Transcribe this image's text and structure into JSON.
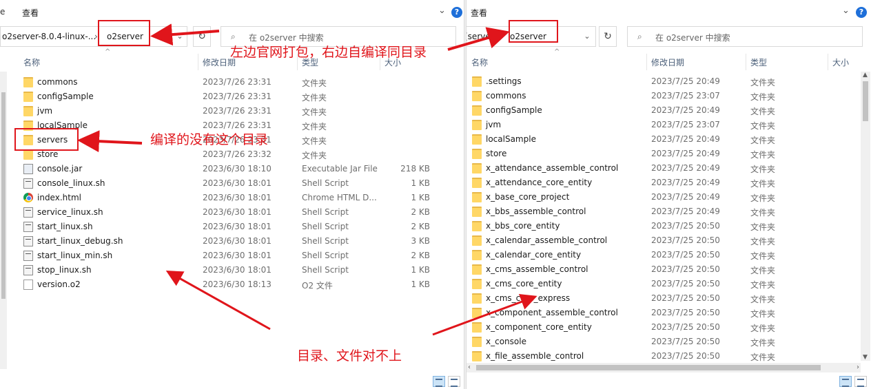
{
  "left": {
    "menu_view": "查看",
    "breadcrumb_parent": "o2server-8.0.4-linux-...",
    "breadcrumb_current": "o2server",
    "search_placeholder": "在 o2server 中搜索",
    "columns": {
      "name": "名称",
      "date": "修改日期",
      "type": "类型",
      "size": "大小"
    },
    "rows": [
      {
        "icon": "folder-icon",
        "name": "commons",
        "date": "2023/7/26 23:31",
        "type": "文件夹",
        "size": ""
      },
      {
        "icon": "folder-icon",
        "name": "configSample",
        "date": "2023/7/26 23:31",
        "type": "文件夹",
        "size": ""
      },
      {
        "icon": "folder-icon",
        "name": "jvm",
        "date": "2023/7/26 23:31",
        "type": "文件夹",
        "size": ""
      },
      {
        "icon": "folder-icon",
        "name": "localSample",
        "date": "2023/7/26 23:31",
        "type": "文件夹",
        "size": ""
      },
      {
        "icon": "folder-icon",
        "name": "servers",
        "date": "2023/7/26 23:31",
        "type": "文件夹",
        "size": ""
      },
      {
        "icon": "folder-icon",
        "name": "store",
        "date": "2023/7/26 23:32",
        "type": "文件夹",
        "size": ""
      },
      {
        "icon": "jar-icon",
        "name": "console.jar",
        "date": "2023/6/30 18:10",
        "type": "Executable Jar File",
        "size": "218 KB"
      },
      {
        "icon": "shell-script-icon",
        "name": "console_linux.sh",
        "date": "2023/6/30 18:01",
        "type": "Shell Script",
        "size": "1 KB"
      },
      {
        "icon": "chrome-icon",
        "name": "index.html",
        "date": "2023/6/30 18:01",
        "type": "Chrome HTML D...",
        "size": "1 KB"
      },
      {
        "icon": "shell-script-icon",
        "name": "service_linux.sh",
        "date": "2023/6/30 18:01",
        "type": "Shell Script",
        "size": "2 KB"
      },
      {
        "icon": "shell-script-icon",
        "name": "start_linux.sh",
        "date": "2023/6/30 18:01",
        "type": "Shell Script",
        "size": "2 KB"
      },
      {
        "icon": "shell-script-icon",
        "name": "start_linux_debug.sh",
        "date": "2023/6/30 18:01",
        "type": "Shell Script",
        "size": "3 KB"
      },
      {
        "icon": "shell-script-icon",
        "name": "start_linux_min.sh",
        "date": "2023/6/30 18:01",
        "type": "Shell Script",
        "size": "2 KB"
      },
      {
        "icon": "shell-script-icon",
        "name": "stop_linux.sh",
        "date": "2023/6/30 18:01",
        "type": "Shell Script",
        "size": "1 KB"
      },
      {
        "icon": "file-icon",
        "name": "version.o2",
        "date": "2023/6/30 18:13",
        "type": "O2 文件",
        "size": "1 KB"
      }
    ]
  },
  "right": {
    "menu_view": "查看",
    "breadcrumb_parent": "(server",
    "breadcrumb_current": "o2server",
    "search_placeholder": "在 o2server 中搜索",
    "columns": {
      "name": "名称",
      "date": "修改日期",
      "type": "类型",
      "size": "大小"
    },
    "rows": [
      {
        "name": ".settings",
        "date": "2023/7/25 20:49",
        "type": "文件夹"
      },
      {
        "name": "commons",
        "date": "2023/7/25 23:07",
        "type": "文件夹"
      },
      {
        "name": "configSample",
        "date": "2023/7/25 20:49",
        "type": "文件夹"
      },
      {
        "name": "jvm",
        "date": "2023/7/25 23:07",
        "type": "文件夹"
      },
      {
        "name": "localSample",
        "date": "2023/7/25 20:49",
        "type": "文件夹"
      },
      {
        "name": "store",
        "date": "2023/7/25 20:49",
        "type": "文件夹"
      },
      {
        "name": "x_attendance_assemble_control",
        "date": "2023/7/25 20:49",
        "type": "文件夹"
      },
      {
        "name": "x_attendance_core_entity",
        "date": "2023/7/25 20:49",
        "type": "文件夹"
      },
      {
        "name": "x_base_core_project",
        "date": "2023/7/25 20:49",
        "type": "文件夹"
      },
      {
        "name": "x_bbs_assemble_control",
        "date": "2023/7/25 20:49",
        "type": "文件夹"
      },
      {
        "name": "x_bbs_core_entity",
        "date": "2023/7/25 20:50",
        "type": "文件夹"
      },
      {
        "name": "x_calendar_assemble_control",
        "date": "2023/7/25 20:50",
        "type": "文件夹"
      },
      {
        "name": "x_calendar_core_entity",
        "date": "2023/7/25 20:50",
        "type": "文件夹"
      },
      {
        "name": "x_cms_assemble_control",
        "date": "2023/7/25 20:50",
        "type": "文件夹"
      },
      {
        "name": "x_cms_core_entity",
        "date": "2023/7/25 20:50",
        "type": "文件夹"
      },
      {
        "name": "x_cms_core_express",
        "date": "2023/7/25 20:50",
        "type": "文件夹"
      },
      {
        "name": "x_component_assemble_control",
        "date": "2023/7/25 20:50",
        "type": "文件夹"
      },
      {
        "name": "x_component_core_entity",
        "date": "2023/7/25 20:50",
        "type": "文件夹"
      },
      {
        "name": "x_console",
        "date": "2023/7/25 20:50",
        "type": "文件夹"
      },
      {
        "name": "x_file_assemble_control",
        "date": "2023/7/25 20:50",
        "type": "文件夹"
      }
    ]
  },
  "annotations": {
    "top": "左边官网打包，右边自编译同目录",
    "middle": "编译的没有这个目录",
    "bottom": "目录、文件对不上"
  },
  "colors": {
    "annotation_red": "#e0151b",
    "folder_yellow": "#ffd766",
    "help_blue": "#1e6fd9"
  }
}
